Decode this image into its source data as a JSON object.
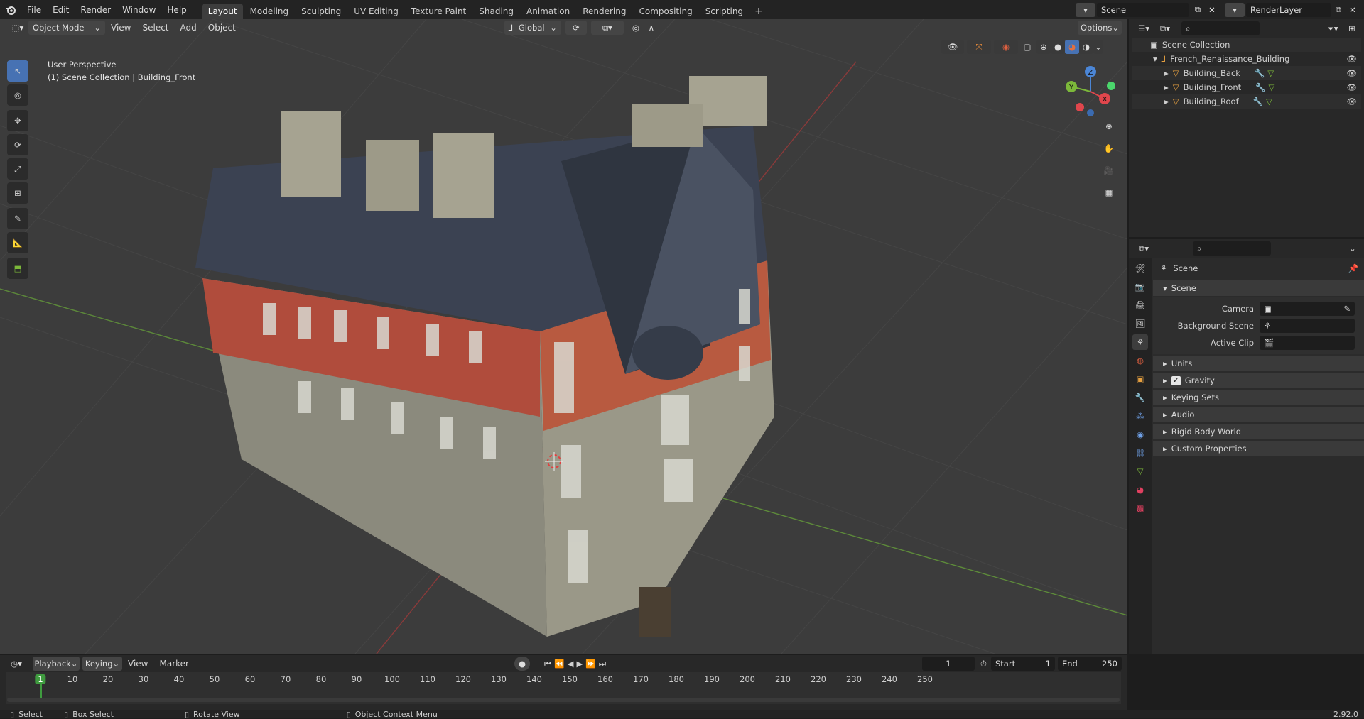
{
  "topbar": {
    "menus": [
      "File",
      "Edit",
      "Render",
      "Window",
      "Help"
    ],
    "workspaces": [
      "Layout",
      "Modeling",
      "Sculpting",
      "UV Editing",
      "Texture Paint",
      "Shading",
      "Animation",
      "Rendering",
      "Compositing",
      "Scripting"
    ],
    "active_workspace": "Layout",
    "add_tab": "+",
    "scene_name": "Scene",
    "view_layer": "RenderLayer"
  },
  "viewport_header": {
    "mode": "Object Mode",
    "menus": [
      "View",
      "Select",
      "Add",
      "Object"
    ],
    "orientation": "Global",
    "options": "Options"
  },
  "viewport": {
    "view_name": "User Perspective",
    "context": "(1) Scene Collection | Building_Front",
    "gizmo": {
      "x": "X",
      "y": "Y",
      "z": "Z"
    }
  },
  "outliner": {
    "root": "Scene Collection",
    "collection": "French_Renaissance_Building",
    "objects": [
      "Building_Back",
      "Building_Front",
      "Building_Roof"
    ]
  },
  "properties": {
    "context_title": "Scene",
    "panel_title": "Scene",
    "camera_label": "Camera",
    "background_label": "Background Scene",
    "clip_label": "Active Clip",
    "subpanels": [
      "Units",
      "Gravity",
      "Keying Sets",
      "Audio",
      "Rigid Body World",
      "Custom Properties"
    ],
    "gravity_checked": true
  },
  "timeline": {
    "menus": [
      "Playback",
      "Keying",
      "View",
      "Marker"
    ],
    "current_frame": "1",
    "start_label": "Start",
    "start": "1",
    "end_label": "End",
    "end": "250",
    "ruler": [
      "1",
      "10",
      "20",
      "30",
      "40",
      "50",
      "60",
      "70",
      "80",
      "90",
      "100",
      "110",
      "120",
      "130",
      "140",
      "150",
      "160",
      "170",
      "180",
      "190",
      "200",
      "210",
      "220",
      "230",
      "240",
      "250"
    ]
  },
  "statusbar": {
    "select": "Select",
    "box_select": "Box Select",
    "rotate": "Rotate View",
    "context_menu": "Object Context Menu",
    "version": "2.92.0"
  },
  "colors": {
    "accent": "#4772b3",
    "object_orange": "#e6a040",
    "x_axis": "#e0464c",
    "y_axis": "#7cb83a",
    "z_axis": "#4b86d6"
  }
}
